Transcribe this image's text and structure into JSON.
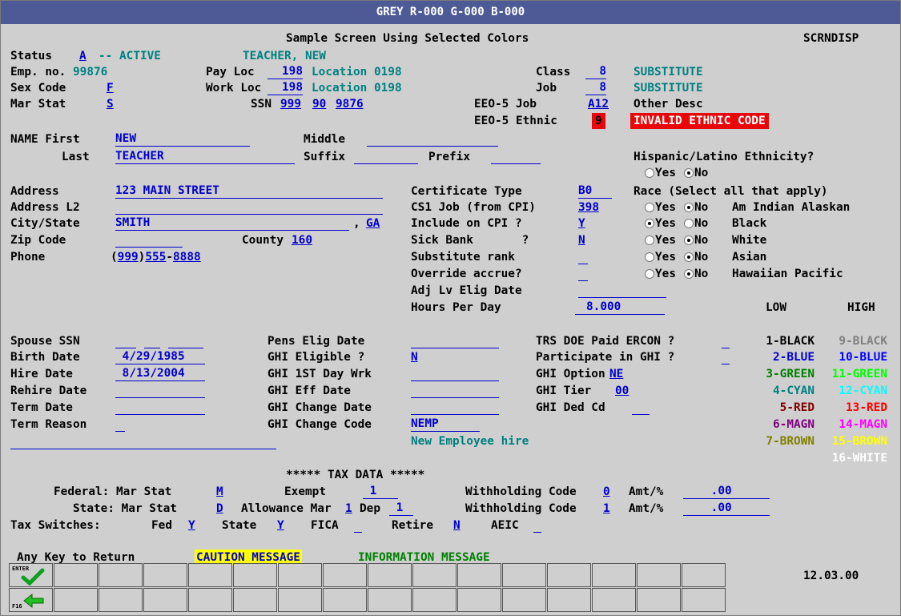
{
  "title": "GREY  R-000 G-000 B-000",
  "screen_title": "Sample Screen Using Selected Colors",
  "screen_id": "SCRNDISP",
  "status": {
    "label": "Status",
    "code": "A",
    "text": "-- ACTIVE",
    "name": "TEACHER, NEW"
  },
  "emp": {
    "label": "Emp. no.",
    "value": "99876"
  },
  "pay_loc": {
    "label": "Pay Loc",
    "value": "198",
    "desc": "Location 0198"
  },
  "work_loc": {
    "label": "Work Loc",
    "value": "198",
    "desc": "Location 0198"
  },
  "sex": {
    "label": "Sex Code",
    "value": "F"
  },
  "mar": {
    "label": "Mar Stat",
    "value": "S"
  },
  "ssn": {
    "label": "SSN",
    "part1": "999",
    "part2": "90",
    "part3": "9876"
  },
  "class": {
    "label": "Class",
    "value": "8",
    "desc": "SUBSTITUTE"
  },
  "job": {
    "label": "Job",
    "value": "8",
    "desc": "SUBSTITUTE"
  },
  "eeo_job": {
    "label": "EEO-5 Job",
    "value": "A12",
    "desc": "Other Desc"
  },
  "eeo_ethnic": {
    "label": "EEO-5 Ethnic",
    "value": "9",
    "desc": "INVALID ETHNIC CODE"
  },
  "name": {
    "first_label": "NAME First",
    "first": "NEW",
    "middle_label": "Middle",
    "middle": "",
    "last_label": "Last",
    "last": "TEACHER",
    "suffix_label": "Suffix",
    "prefix_label": "Prefix"
  },
  "hispanic": {
    "label": "Hispanic/Latino Ethnicity?",
    "yes": "Yes",
    "no": "No"
  },
  "address": {
    "label": "Address",
    "value": "123 MAIN STREET",
    "l2_label": "Address L2",
    "city_label": "City/State",
    "city": "SMITH",
    "comma": ",",
    "state": "GA",
    "zip_label": "Zip Code",
    "county_label": "County",
    "county": "160",
    "phone_label": "Phone",
    "phone_area": "999",
    "phone_pre": "555",
    "phone_num": "8888"
  },
  "cert": {
    "label": "Certificate Type",
    "value": "B0"
  },
  "cs1": {
    "label": "CS1 Job (from CPI)",
    "value": "398"
  },
  "cpi": {
    "label": "Include on CPI ?",
    "value": "Y"
  },
  "sick": {
    "label": "Sick Bank       ?",
    "value": "N"
  },
  "subrank": {
    "label": "Substitute rank"
  },
  "override": {
    "label": "Override accrue?"
  },
  "adj": {
    "label": "Adj Lv Elig Date"
  },
  "hours": {
    "label": "Hours Per Day",
    "value": "8.000"
  },
  "race": {
    "label": "Race (Select all that apply)",
    "items": [
      "Am Indian Alaskan",
      "Black",
      "White",
      "Asian",
      "Hawaiian Pacific"
    ],
    "yes": "Yes",
    "no": "No"
  },
  "low_label": "LOW",
  "high_label": "HIGH",
  "colors": {
    "low": [
      "1-BLACK",
      "2-BLUE",
      "3-GREEN",
      "4-CYAN",
      "5-RED",
      "6-MAGN",
      "7-BROWN"
    ],
    "high": [
      "9-BLACK",
      "10-BLUE",
      "11-GREEN",
      "12-CYAN",
      "13-RED",
      "14-MAGN",
      "15-BROWN",
      "16-WHITE"
    ],
    "low_hex": [
      "#000000",
      "#0000cc",
      "#008000",
      "#008080",
      "#800000",
      "#800080",
      "#808000"
    ],
    "high_hex": [
      "#808080",
      "#0000ff",
      "#00ff00",
      "#00ffff",
      "#ff0000",
      "#ff00ff",
      "#ffff00",
      "#ffffff"
    ]
  },
  "spouse": {
    "label": "Spouse SSN"
  },
  "birth": {
    "label": "Birth Date",
    "value": " 4/29/1985"
  },
  "hire": {
    "label": "Hire Date",
    "value": " 8/13/2004"
  },
  "rehire": {
    "label": "Rehire Date"
  },
  "term": {
    "label": "Term Date"
  },
  "termr": {
    "label": "Term Reason"
  },
  "pens": {
    "label": "Pens Elig Date"
  },
  "ghi_elig": {
    "label": "GHI Eligible ?",
    "value": "N"
  },
  "ghi_first": {
    "label": "GHI 1ST Day Wrk"
  },
  "ghi_eff": {
    "label": "GHI Eff Date"
  },
  "ghi_chg_date": {
    "label": "GHI Change Date"
  },
  "ghi_chg_code": {
    "label": "GHI Change Code",
    "value": "NEMP",
    "desc": "New Employee hire"
  },
  "trs": {
    "label": "TRS DOE Paid ERCON ?"
  },
  "part_ghi": {
    "label": "Participate in GHI ?"
  },
  "ghi_opt": {
    "label": "GHI Option",
    "value": "NE"
  },
  "ghi_tier": {
    "label": "GHI Tier",
    "value": "00"
  },
  "ghi_ded": {
    "label": "GHI Ded Cd"
  },
  "tax": {
    "header": "***** TAX DATA *****",
    "fed_label": "Federal: Mar Stat",
    "fed_mar": "M",
    "exempt_label": "Exempt",
    "exempt": " 1",
    "wc_label": "Withholding Code",
    "fed_wc": "0",
    "amt_label": "Amt/%",
    "fed_amt": "    .00",
    "state_label": "State: Mar Stat",
    "state_mar": "D",
    "allow_label": "Allowance Mar",
    "allow": "1",
    "dep_label": "Dep",
    "dep": " 1",
    "state_wc": "1",
    "state_amt": "    .00",
    "switch_label": "Tax Switches:",
    "fed": "Fed",
    "fed_v": "Y",
    "state": "State",
    "state_v": "Y",
    "fica": "FICA",
    "retire": "Retire",
    "retire_v": "N",
    "aeic": "AEIC"
  },
  "footer": {
    "return": "Any Key to Return",
    "caution": "CAUTION MESSAGE",
    "info": "INFORMATION MESSAGE",
    "version": "12.03.00",
    "enter_key": "ENTER",
    "f16_key": "F16"
  }
}
